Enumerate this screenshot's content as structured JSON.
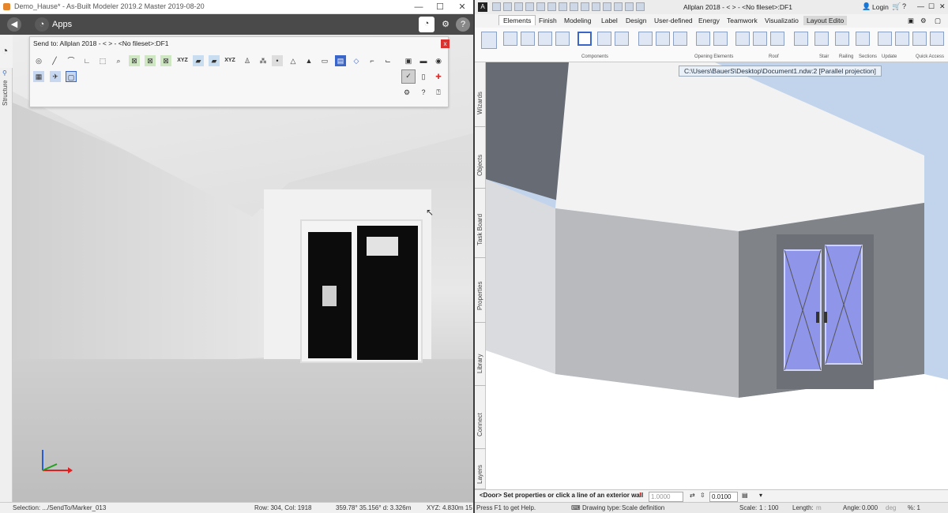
{
  "left": {
    "window_title": "Demo_Hause* - As-Built Modeler 2019.2 Master 2019-08-20",
    "window_controls": {
      "minimize": "—",
      "maximize": "☐",
      "close": "✕"
    },
    "app_bar": {
      "title": "Apps"
    },
    "side_tab": "Structure",
    "panel": {
      "title": "Send to: Allplan 2018 - <     > - <No fileset>:DF1",
      "close": "x",
      "icon_labels": {
        "xyz1": "XYZ",
        "xyz2": "XYZ"
      }
    },
    "status": {
      "selection": "Selection: .../SendTo/Marker_013",
      "rowcol": "Row: 304, Col: 1918",
      "angles": "359.78° 35.156° d: 3.326m",
      "xyz": "XYZ: 4.830m 15"
    }
  },
  "right": {
    "window_title": "Allplan 2018 - <     > - <No fileset>:DF1",
    "login": "Login",
    "menu_tabs": [
      "Elements",
      "Finish",
      "Modeling",
      "Label",
      "Design",
      "User-defined",
      "Energy",
      "Teamwork",
      "Visualizatio",
      "Layout Edito"
    ],
    "ribbon_groups": [
      "Components",
      "Opening Elements",
      "Roof",
      "Stair",
      "Railing",
      "Sections",
      "Update",
      "Quick Access"
    ],
    "path_label": "C:\\Users\\BauerS\\Desktop\\Document1.ndw:2 [Parallel projection]",
    "side_tabs": [
      "Wizards",
      "Objects",
      "Task Board",
      "Properties",
      "Library",
      "Connect",
      "Layers"
    ],
    "command_prompt": "<Door> Set properties or click a line of an exterior wall",
    "input_value": "1.0000",
    "input_value2": "0.0100",
    "status": {
      "help": "Press F1 to get Help.",
      "drawing_type_label": "Drawing type:",
      "drawing_type": "Scale definition",
      "scale_label": "Scale:",
      "scale": "1 : 100",
      "length_label": "Length:",
      "length_unit": "m",
      "angle_label": "Angle:",
      "angle": "0.000",
      "angle_unit": "deg",
      "percent": "%: 1"
    }
  }
}
